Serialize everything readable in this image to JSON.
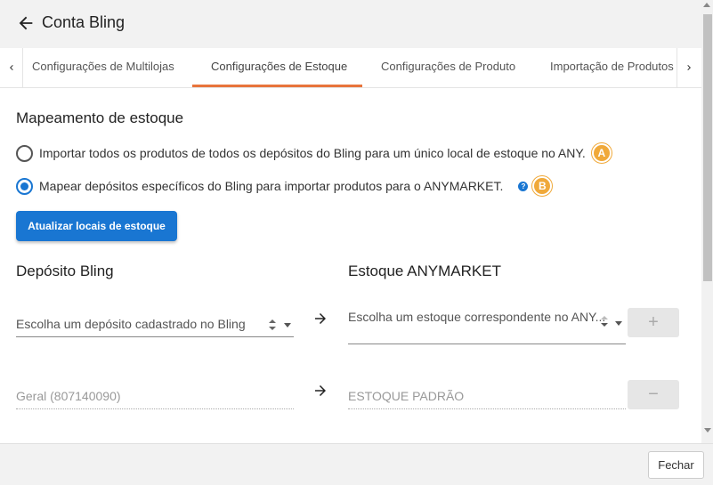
{
  "header": {
    "title": "Conta Bling",
    "back_icon": "arrow-left-icon"
  },
  "tabs": [
    {
      "label": "Configurações de Multilojas",
      "active": false
    },
    {
      "label": "Configurações de Estoque",
      "active": true
    },
    {
      "label": "Configurações de Produto",
      "active": false
    },
    {
      "label": "Importação de Produtos",
      "active": false
    }
  ],
  "colors": {
    "accent": "#1976d2",
    "tab_underline": "#e8743b",
    "badge": "#f0a93a"
  },
  "section": {
    "title": "Mapeamento de estoque",
    "option_a": {
      "label": "Importar todos os produtos de todos os depósitos do Bling para um único local de estoque no ANY.",
      "badge": "A",
      "selected": false
    },
    "option_b": {
      "label": "Mapear depósitos específicos do Bling para importar produtos para o ANYMARKET.",
      "badge": "B",
      "selected": true
    },
    "help_icon": "?"
  },
  "update_button": "Atualizar locais de estoque",
  "columns": {
    "left_title": "Depósito Bling",
    "right_title": "Estoque ANYMARKET"
  },
  "row_new": {
    "left_placeholder": "Escolha um depósito cadastrado no Bling",
    "right_placeholder": "Escolha um estoque correspondente no ANY...",
    "add_button": "+"
  },
  "row_mapped": {
    "left_value": "Geral (807140090)",
    "right_value": "ESTOQUE PADRÃO",
    "remove_button": "−"
  },
  "footer": {
    "close_button": "Fechar"
  }
}
